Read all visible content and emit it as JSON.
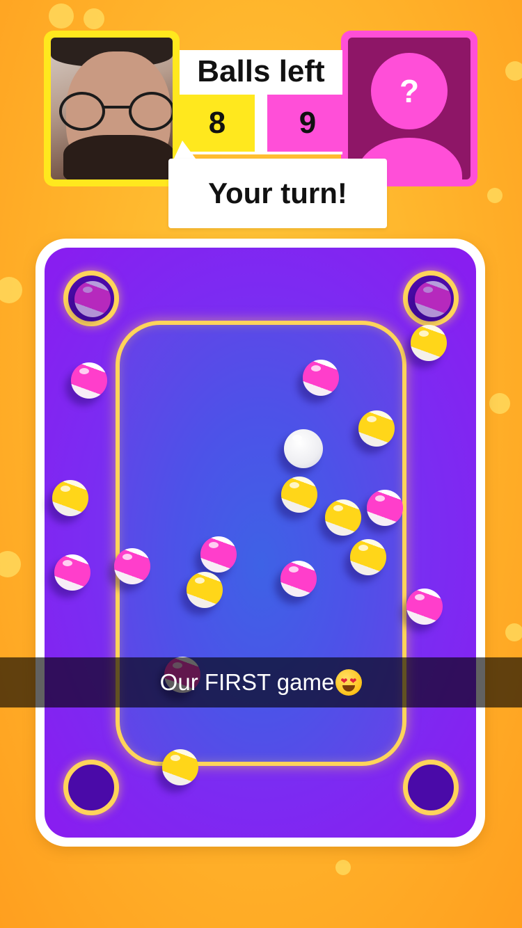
{
  "header": {
    "balls_left_title": "Balls left",
    "player1_score": "8",
    "player2_score": "9",
    "opponent_placeholder": "?",
    "turn_message": "Your turn!"
  },
  "caption": {
    "text": "Our FIRST game"
  },
  "colors": {
    "player1": "#ffe81e",
    "player2": "#ff4fd8",
    "board": "#7a2df2",
    "rail": "#ffd45a"
  },
  "icons": {
    "opponent": "unknown-player-icon",
    "caption_emoji": "heart-eyes-emoji"
  }
}
